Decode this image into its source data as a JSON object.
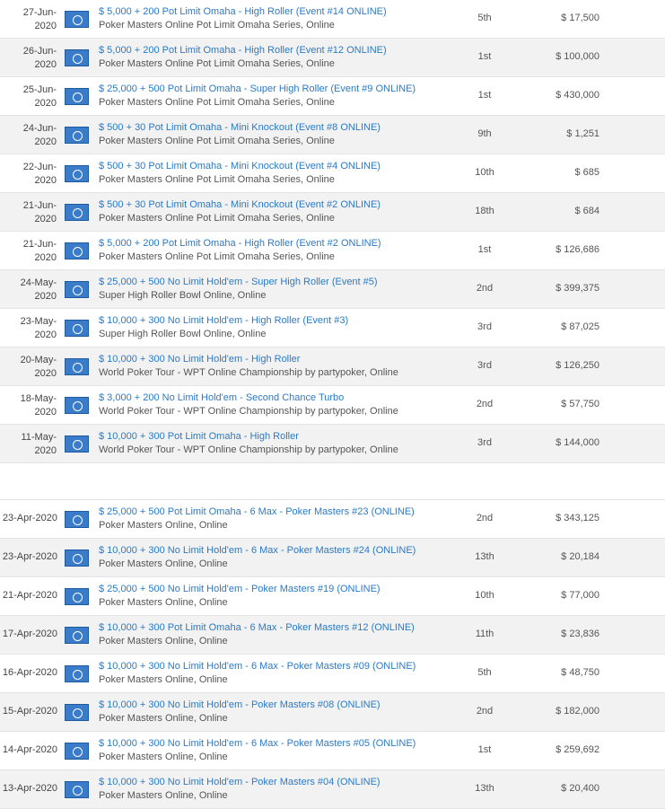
{
  "results": [
    {
      "date_top": "27-Jun-",
      "date_bottom": "2020",
      "event": "$ 5,000 + 200 Pot Limit Omaha - High Roller (Event #14 ONLINE)",
      "series": "Poker Masters Online Pot Limit Omaha Series, Online",
      "place": "5th",
      "prize": "$ 17,500"
    },
    {
      "date_top": "26-Jun-",
      "date_bottom": "2020",
      "event": "$ 5,000 + 200 Pot Limit Omaha - High Roller (Event #12 ONLINE)",
      "series": "Poker Masters Online Pot Limit Omaha Series, Online",
      "place": "1st",
      "prize": "$ 100,000"
    },
    {
      "date_top": "25-Jun-",
      "date_bottom": "2020",
      "event": "$ 25,000 + 500 Pot Limit Omaha - Super High Roller (Event #9 ONLINE)",
      "series": "Poker Masters Online Pot Limit Omaha Series, Online",
      "place": "1st",
      "prize": "$ 430,000"
    },
    {
      "date_top": "24-Jun-",
      "date_bottom": "2020",
      "event": "$ 500 + 30 Pot Limit Omaha - Mini Knockout (Event #8 ONLINE)",
      "series": "Poker Masters Online Pot Limit Omaha Series, Online",
      "place": "9th",
      "prize": "$ 1,251"
    },
    {
      "date_top": "22-Jun-",
      "date_bottom": "2020",
      "event": "$ 500 + 30 Pot Limit Omaha - Mini Knockout (Event #4 ONLINE)",
      "series": "Poker Masters Online Pot Limit Omaha Series, Online",
      "place": "10th",
      "prize": "$ 685"
    },
    {
      "date_top": "21-Jun-",
      "date_bottom": "2020",
      "event": "$ 500 + 30 Pot Limit Omaha - Mini Knockout (Event #2 ONLINE)",
      "series": "Poker Masters Online Pot Limit Omaha Series, Online",
      "place": "18th",
      "prize": "$ 684"
    },
    {
      "date_top": "21-Jun-",
      "date_bottom": "2020",
      "event": "$ 5,000 + 200 Pot Limit Omaha - High Roller (Event #2 ONLINE)",
      "series": "Poker Masters Online Pot Limit Omaha Series, Online",
      "place": "1st",
      "prize": "$ 126,686"
    },
    {
      "date_top": "24-May-",
      "date_bottom": "2020",
      "event": "$ 25,000 + 500 No Limit Hold'em - Super High Roller (Event #5)",
      "series": "Super High Roller Bowl Online, Online",
      "place": "2nd",
      "prize": "$ 399,375"
    },
    {
      "date_top": "23-May-",
      "date_bottom": "2020",
      "event": "$ 10,000 + 300 No Limit Hold'em - High Roller (Event #3)",
      "series": "Super High Roller Bowl Online, Online",
      "place": "3rd",
      "prize": "$ 87,025"
    },
    {
      "date_top": "20-May-",
      "date_bottom": "2020",
      "event": "$ 10,000 + 300 No Limit Hold'em - High Roller",
      "series": "World Poker Tour - WPT Online Championship by partypoker, Online",
      "place": "3rd",
      "prize": "$ 126,250"
    },
    {
      "date_top": "18-May-",
      "date_bottom": "2020",
      "event": "$ 3,000 + 200 No Limit Hold'em - Second Chance Turbo",
      "series": "World Poker Tour - WPT Online Championship by partypoker, Online",
      "place": "2nd",
      "prize": "$ 57,750"
    },
    {
      "date_top": "11-May-",
      "date_bottom": "2020",
      "event": "$ 10,000 + 300 Pot Limit Omaha - High Roller",
      "series": "World Poker Tour - WPT Online Championship by partypoker, Online",
      "place": "3rd",
      "prize": "$ 144,000"
    }
  ],
  "results_april": [
    {
      "date": "23-Apr-2020",
      "event": "$ 25,000 + 500 Pot Limit Omaha - 6 Max - Poker Masters #23 (ONLINE)",
      "series": "Poker Masters Online, Online",
      "place": "2nd",
      "prize": "$ 343,125"
    },
    {
      "date": "23-Apr-2020",
      "event": "$ 10,000 + 300 No Limit Hold'em - 6 Max - Poker Masters #24 (ONLINE)",
      "series": "Poker Masters Online, Online",
      "place": "13th",
      "prize": "$ 20,184"
    },
    {
      "date": "21-Apr-2020",
      "event": "$ 25,000 + 500 No Limit Hold'em - Poker Masters #19 (ONLINE)",
      "series": "Poker Masters Online, Online",
      "place": "10th",
      "prize": "$ 77,000"
    },
    {
      "date": "17-Apr-2020",
      "event": "$ 10,000 + 300 Pot Limit Omaha - 6 Max - Poker Masters #12 (ONLINE)",
      "series": "Poker Masters Online, Online",
      "place": "11th",
      "prize": "$ 23,836"
    },
    {
      "date": "16-Apr-2020",
      "event": "$ 10,000 + 300 No Limit Hold'em - 6 Max - Poker Masters #09 (ONLINE)",
      "series": "Poker Masters Online, Online",
      "place": "5th",
      "prize": "$ 48,750"
    },
    {
      "date": "15-Apr-2020",
      "event": "$ 10,000 + 300 No Limit Hold'em - Poker Masters #08 (ONLINE)",
      "series": "Poker Masters Online, Online",
      "place": "2nd",
      "prize": "$ 182,000"
    },
    {
      "date": "14-Apr-2020",
      "event": "$ 10,000 + 300 No Limit Hold'em - 6 Max - Poker Masters #05 (ONLINE)",
      "series": "Poker Masters Online, Online",
      "place": "1st",
      "prize": "$ 259,692"
    },
    {
      "date": "13-Apr-2020",
      "event": "$ 10,000 + 300 No Limit Hold'em - Poker Masters #04 (ONLINE)",
      "series": "Poker Masters Online, Online",
      "place": "13th",
      "prize": "$ 20,400"
    }
  ]
}
